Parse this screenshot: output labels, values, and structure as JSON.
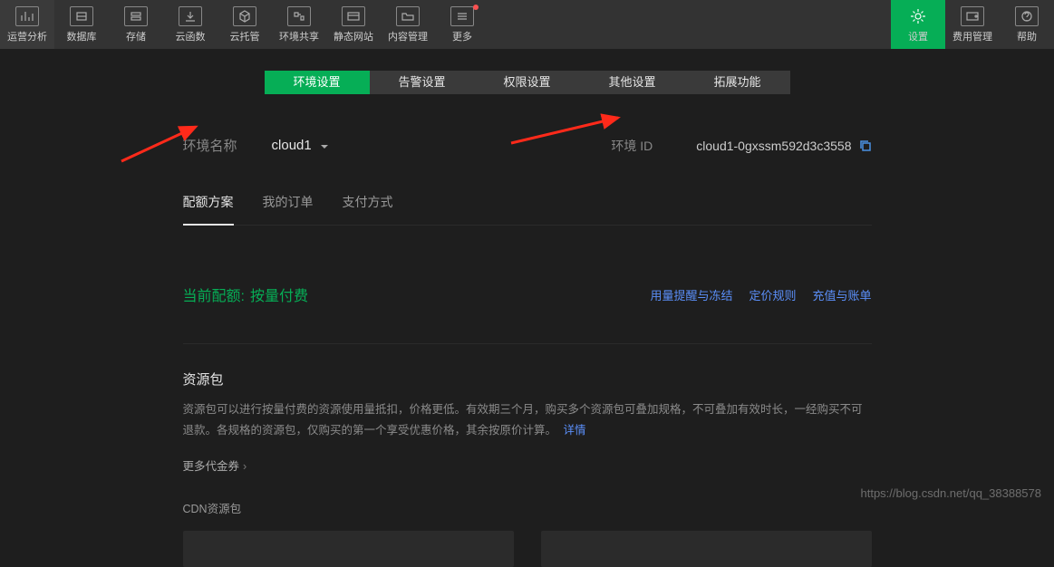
{
  "toolbar": {
    "left": [
      {
        "id": "analytics",
        "label": "运营分析"
      },
      {
        "id": "database",
        "label": "数据库"
      },
      {
        "id": "storage",
        "label": "存储"
      },
      {
        "id": "cloudfunc",
        "label": "云函数"
      },
      {
        "id": "cloudhost",
        "label": "云托管"
      },
      {
        "id": "envshare",
        "label": "环境共享"
      },
      {
        "id": "static",
        "label": "静态网站"
      },
      {
        "id": "content",
        "label": "内容管理"
      },
      {
        "id": "more",
        "label": "更多",
        "red_dot": true
      }
    ],
    "right": [
      {
        "id": "settings",
        "label": "设置",
        "active": true
      },
      {
        "id": "billing",
        "label": "费用管理"
      },
      {
        "id": "help",
        "label": "帮助"
      }
    ]
  },
  "subtabs": [
    {
      "id": "env",
      "label": "环境设置",
      "active": true
    },
    {
      "id": "alert",
      "label": "告警设置"
    },
    {
      "id": "perm",
      "label": "权限设置"
    },
    {
      "id": "other",
      "label": "其他设置"
    },
    {
      "id": "ext",
      "label": "拓展功能"
    }
  ],
  "env": {
    "name_label": "环境名称",
    "name_value": "cloud1",
    "id_label": "环境 ID",
    "id_value": "cloud1-0gxssm592d3c3558"
  },
  "tabs2": [
    {
      "id": "quota",
      "label": "配额方案",
      "active": true
    },
    {
      "id": "orders",
      "label": "我的订单"
    },
    {
      "id": "pay",
      "label": "支付方式"
    }
  ],
  "quota": {
    "current_label": "当前配额:",
    "current_value": "按量付费",
    "links": [
      "用量提醒与冻结",
      "定价规则",
      "充值与账单"
    ]
  },
  "resource": {
    "title": "资源包",
    "desc": "资源包可以进行按量付费的资源使用量抵扣，价格更低。有效期三个月，购买多个资源包可叠加规格，不可叠加有效时长，一经购买不可退款。各规格的资源包，仅购买的第一个享受优惠价格，其余按原价计算。",
    "detail": "详情",
    "more_coupon": "更多代金券",
    "cdn_title": "CDN资源包"
  },
  "watermark": "https://blog.csdn.net/qq_38388578"
}
